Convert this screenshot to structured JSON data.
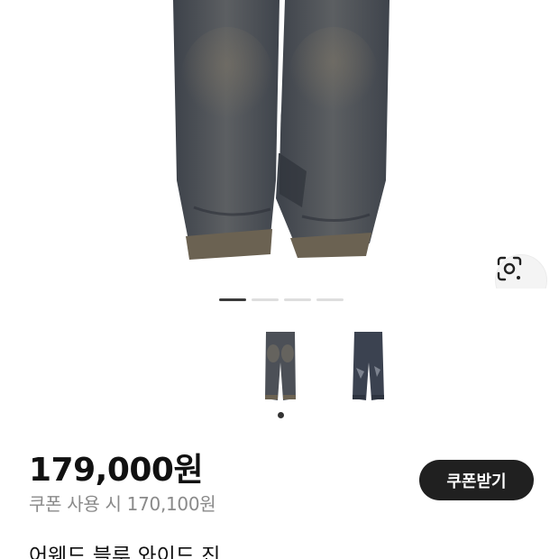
{
  "product": {
    "price": "179,000원",
    "coupon_price": "쿠폰 사용 시 170,100원",
    "title": "어웨드 블루 와이드 진"
  },
  "actions": {
    "coupon_button": "쿠폰받기"
  },
  "gallery": {
    "page_count": 4,
    "active_page": 1,
    "thumbnails": [
      "jeans-front-thumbnail",
      "jeans-back-thumbnail"
    ],
    "active_thumbnail": 1
  },
  "icons": {
    "lens": "visual-search-icon"
  },
  "colors": {
    "denim": "#4a5058",
    "button_bg": "#202020",
    "muted_text": "#8a8a8a"
  }
}
